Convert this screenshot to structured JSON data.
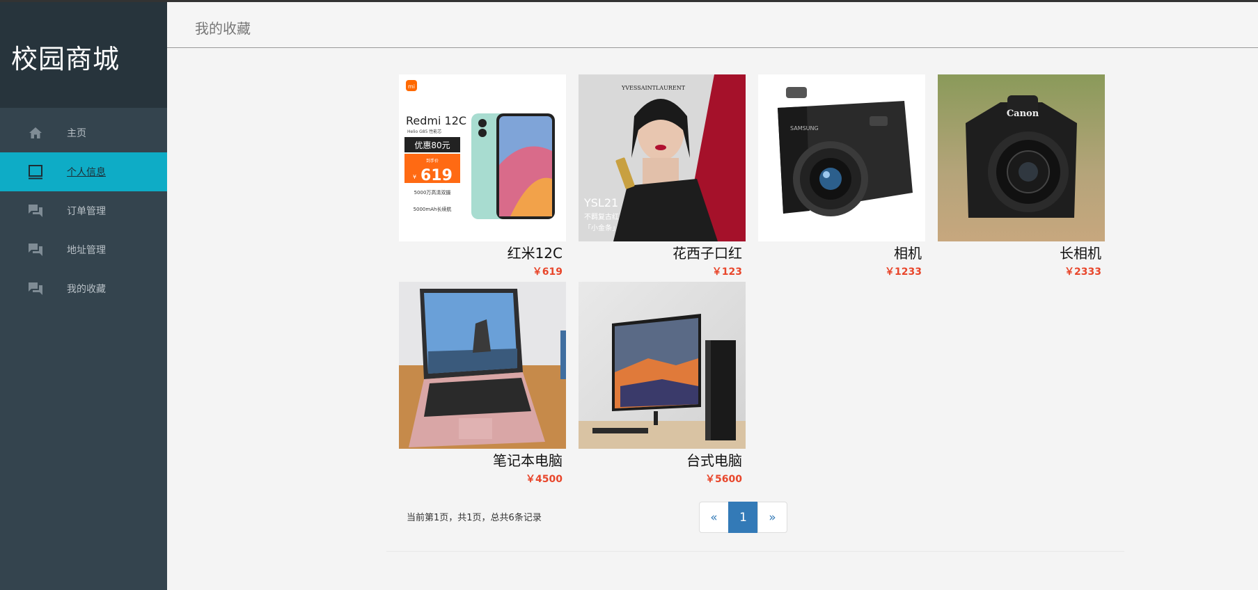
{
  "sidebar": {
    "brand": "校园商城",
    "items": [
      {
        "label": "主页",
        "icon": "home-icon"
      },
      {
        "label": "个人信息",
        "icon": "profile-icon",
        "active": true
      },
      {
        "label": "订单管理",
        "icon": "chat-icon"
      },
      {
        "label": "地址管理",
        "icon": "chat-icon"
      },
      {
        "label": "我的收藏",
        "icon": "chat-icon"
      }
    ]
  },
  "header": {
    "title": "我的收藏"
  },
  "products": [
    {
      "name": "红米12C",
      "price": "￥619",
      "thumb_text": {
        "model": "Redmi 12C",
        "chip": "Helio G85 性能芯",
        "coupon": "优惠80元",
        "price_tag": "到手价",
        "price": "619",
        "currency": "¥",
        "spec1": "5000万高清双摄",
        "spec2": "5000mAh长续航",
        "logo": "mi"
      }
    },
    {
      "name": "花西子口红",
      "price": "￥123",
      "thumb_text": {
        "brand": "YVESSAINTLAURENT",
        "line1": "YSL21",
        "line2": "不羁复古红",
        "line3": "「小金条」"
      }
    },
    {
      "name": "相机",
      "price": "￥1233",
      "thumb_text": {
        "brand": "SAMSUNG"
      }
    },
    {
      "name": "长相机",
      "price": "￥2333",
      "thumb_text": {
        "brand": "Canon"
      }
    },
    {
      "name": "笔记本电脑",
      "price": "￥4500",
      "thumb_text": {}
    },
    {
      "name": "台式电脑",
      "price": "￥5600",
      "thumb_text": {}
    }
  ],
  "pagination": {
    "record_text": "当前第1页，共1页，总共6条记录",
    "prev": "«",
    "current": "1",
    "next": "»"
  },
  "colors": {
    "sidebar": "#34444e",
    "brand_bg": "#27343c",
    "active": "#0eacc6",
    "price": "#e8462b",
    "page_active": "#337ab7"
  }
}
